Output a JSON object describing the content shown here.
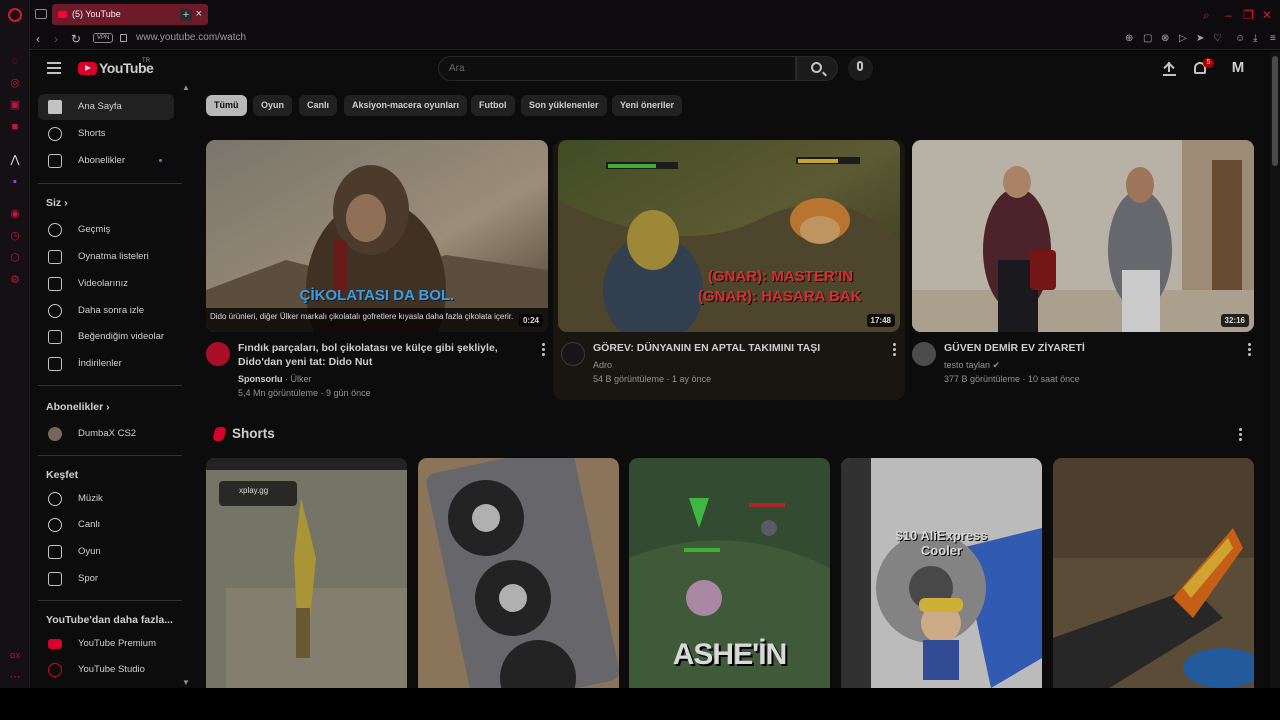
{
  "browser": {
    "tab_title": "(5) YouTube",
    "tab_close": "×",
    "new_tab": "+",
    "vpn": "VPN",
    "url": "www.youtube.com/watch",
    "back": "‹",
    "forward": "›",
    "reload": "↻"
  },
  "youtube": {
    "logo_text": "YouTube",
    "logo_region": "TR",
    "search_placeholder": "Ara",
    "notifications_count": "5",
    "avatar_letter": "M"
  },
  "sidebar": {
    "main": [
      {
        "label": "Ana Sayfa",
        "icon": "home-icon"
      },
      {
        "label": "Shorts",
        "icon": "shorts-icon"
      },
      {
        "label": "Abonelikler",
        "icon": "subscriptions-icon"
      }
    ],
    "you_heading": "Siz",
    "you": [
      {
        "label": "Geçmiş",
        "icon": "history-icon"
      },
      {
        "label": "Oynatma listeleri",
        "icon": "playlists-icon"
      },
      {
        "label": "Videolarınız",
        "icon": "your-videos-icon"
      },
      {
        "label": "Daha sonra izle",
        "icon": "watch-later-icon"
      },
      {
        "label": "Beğendiğim videolar",
        "icon": "liked-icon"
      },
      {
        "label": "İndirilenler",
        "icon": "downloads-icon"
      }
    ],
    "subs_heading": "Abonelikler",
    "subs": [
      {
        "label": "DumbaX CS2",
        "icon": "channel-avatar"
      }
    ],
    "explore_heading": "Keşfet",
    "explore": [
      {
        "label": "Müzik",
        "icon": "music-icon"
      },
      {
        "label": "Canlı",
        "icon": "live-icon"
      },
      {
        "label": "Oyun",
        "icon": "gaming-icon"
      },
      {
        "label": "Spor",
        "icon": "sports-icon"
      }
    ],
    "more_heading": "YouTube'dan daha fazla...",
    "more": [
      {
        "label": "YouTube Premium",
        "icon": "youtube-premium-icon"
      },
      {
        "label": "YouTube Studio",
        "icon": "youtube-studio-icon"
      }
    ]
  },
  "chips": [
    "Tümü",
    "Oyun",
    "Canlı",
    "Aksiyon-macera oyunları",
    "Futbol",
    "Son yüklenenler",
    "Yeni öneriler"
  ],
  "videos": [
    {
      "title": "Fındık parçaları, bol çikolatası ve külçe gibi şekliyle, Dido'dan yeni tat: Dido Nut",
      "channel": "Sponsorlu",
      "channel_suffix": " · Ülker",
      "views": "5,4 Mn görüntüleme · 9 gün önce",
      "duration": "0:24",
      "overlay_text": "ÇİKOLATASI DA BOL.",
      "caption": "Dido ürünleri, diğer Ülker markalı çikolatalı gofretlere kıyasla daha fazla çikolata içerir."
    },
    {
      "title": "GÖREV: DÜNYANIN EN APTAL TAKIMINI TAŞI",
      "channel": "Adro",
      "views": "54 B görüntüleme · 1 ay önce",
      "duration": "17:48",
      "overlay_text_1": "(GNAR): MASTER'IN",
      "overlay_text_2": "(GNAR): HASARA BAK"
    },
    {
      "title": "GÜVEN DEMİR EV ZİYARETİ",
      "channel": "testo taylan",
      "views": "377 B görüntüleme · 10 saat önce",
      "duration": "32:16"
    }
  ],
  "shorts": {
    "title": "Shorts",
    "items": [
      {
        "overlay": "xplay.gg"
      },
      {
        "overlay": ""
      },
      {
        "overlay": "ASHE'İN"
      },
      {
        "overlay": "$10 AliExpress Cooler"
      },
      {
        "overlay": ""
      }
    ]
  },
  "colors": {
    "accent_red": "#ff0033",
    "opera_red": "#e0103a",
    "background": "#0f0f0f"
  }
}
